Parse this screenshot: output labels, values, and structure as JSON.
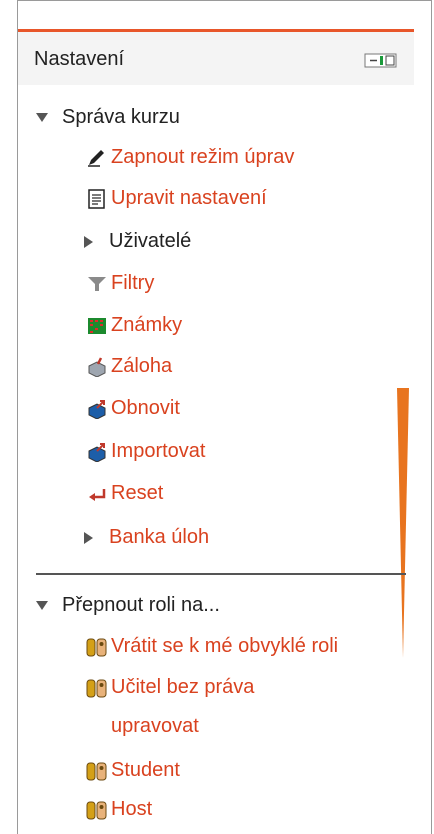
{
  "block": {
    "title": "Nastavení"
  },
  "sections": [
    {
      "label": "Správa kurzu",
      "items": [
        {
          "label": "Zapnout režim úprav",
          "icon": "edit-pencil-icon",
          "type": "link"
        },
        {
          "label": "Upravit nastavení",
          "icon": "settings-document-icon",
          "type": "link"
        },
        {
          "label": "Uživatelé",
          "icon": "expand-arrow-icon",
          "type": "folder"
        },
        {
          "label": "Filtry",
          "icon": "filter-funnel-icon",
          "type": "link"
        },
        {
          "label": "Známky",
          "icon": "grades-table-icon",
          "type": "link"
        },
        {
          "label": "Záloha",
          "icon": "backup-box-icon",
          "type": "link"
        },
        {
          "label": "Obnovit",
          "icon": "restore-box-icon",
          "type": "link"
        },
        {
          "label": "Importovat",
          "icon": "import-box-icon",
          "type": "link"
        },
        {
          "label": "Reset",
          "icon": "reset-arrow-icon",
          "type": "link"
        },
        {
          "label": "Banka úloh",
          "icon": "expand-arrow-icon",
          "type": "folder-link"
        }
      ]
    },
    {
      "label": "Přepnout roli na...",
      "items": [
        {
          "label_line1": "Vrátit se k mé obvyklé roli",
          "icon": "role-users-icon"
        },
        {
          "label_line1": "Učitel bez práva",
          "label_line2": "upravovat",
          "icon": "role-users-icon"
        },
        {
          "label_line1": "Student",
          "icon": "role-users-icon"
        },
        {
          "label_line1": "Host",
          "icon": "role-users-icon"
        }
      ]
    }
  ],
  "colors": {
    "link": "#d9421f",
    "accent_border": "#e8562a",
    "header_bg": "#f4f4f4"
  }
}
